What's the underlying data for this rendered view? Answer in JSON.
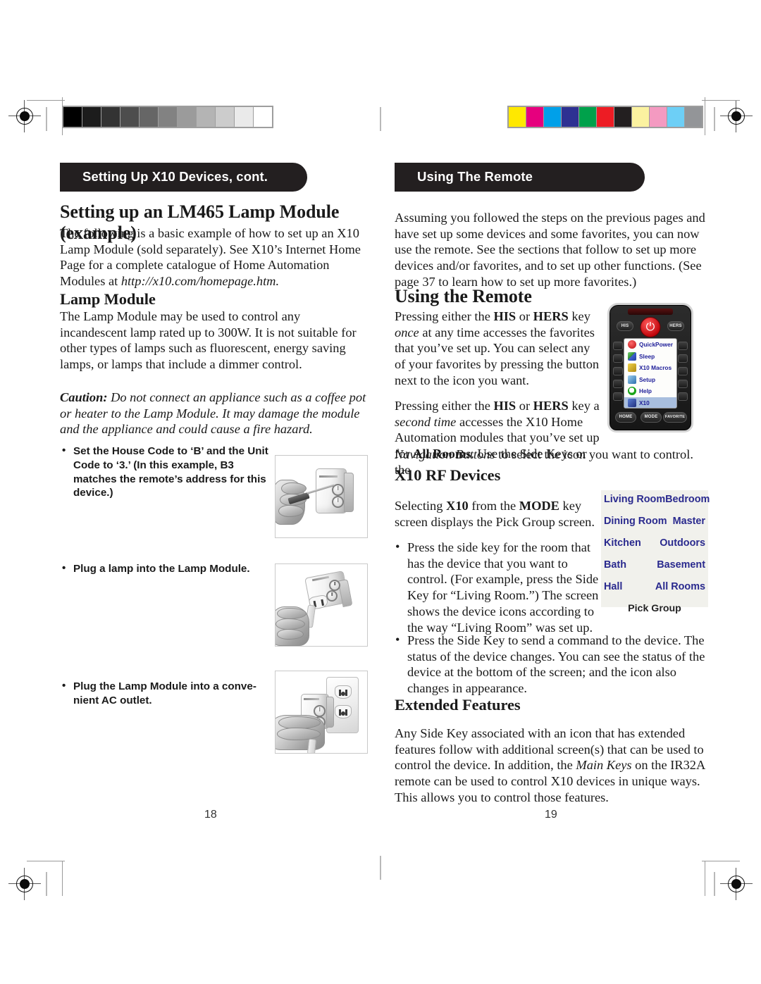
{
  "document": {
    "type": "printed-manual-spread",
    "left_page_number": "18",
    "right_page_number": "19"
  },
  "print_marks": {
    "grayscale_wedge": [
      "#000000",
      "#1c1c1c",
      "#333333",
      "#4d4d4d",
      "#666666",
      "#828282",
      "#9b9b9b",
      "#b4b4b4",
      "#cccccc",
      "#eaeaea",
      "#ffffff"
    ],
    "color_bar": [
      "#ffe800",
      "#e6007e",
      "#00a0e9",
      "#2e3192",
      "#00a14b",
      "#ed1c24",
      "#231f20",
      "#fbf2a0",
      "#f49ac1",
      "#6dcff6",
      "#939598"
    ]
  },
  "left_page": {
    "section_bar": "Setting Up X10 Devices, cont.",
    "heading_lm465": "Setting up an LM465 Lamp Module (example)",
    "intro": "The following is a basic example of how to set up an X10 Lamp Module (sold separately). See X10’s Internet Home Page for a complete catalogue of Home Automation Modules at ",
    "intro_url": "http://x10.com/homepage.htm.",
    "heading_lamp_module": "Lamp Module",
    "lamp_module_text": "The Lamp Module may be used to control any incandescent lamp rated up to 300W. It is not suitable for other types of lamps such as fluorescent, energy saving lamps, or lamps that include a dimmer control.",
    "caution_label": "Caution:",
    "caution_text": " Do not connect an appliance such as a coffee pot or heater to the Lamp Module. It may damage the module and the appliance and could cause a fire hazard.",
    "steps": [
      "Set the House Code to ‘B’ and the Unit Code to ‘3.’ (In this example, B3 matches the remote’s address for this device.)",
      "Plug a lamp into the Lamp Module.",
      "Plug the Lamp Module into a conve-\nnient AC outlet."
    ],
    "photo_captions": [
      "photo-setting-house-and-unit-code-with-screwdriver",
      "photo-plugging-lamp-cord-into-module",
      "photo-plugging-module-into-wall-outlet"
    ]
  },
  "right_page": {
    "section_bar": "Using The Remote",
    "intro": "Assuming you followed the steps on the previous pages and have set up some devices and some favorites, you can now use the remote. See the sections that follow to set up more devices and/or favorites, and to set up other functions. (See page 37 to learn how to set up more favorites.)",
    "heading_using_remote": "Using the Remote",
    "para1": {
      "a": "Pressing either the ",
      "his": "HIS",
      "b": " or ",
      "hers": "HERS",
      "c": " key ",
      "once": "once",
      "d": " at any time accesses the favorites that you’ve set up. You can select any of your favorites by pressing the button next to the icon you want."
    },
    "para2": {
      "a": "Pressing either the ",
      "his": "HIS",
      "b": " or ",
      "hers": "HERS",
      "c": " key a ",
      "second_time": "second time",
      "d": " accesses the X10 Home Automation modules that you’ve set up for ",
      "all_rooms": "All Rooms",
      "e": ". Use the Side Keys or the ",
      "nav": "Navigation Buttons",
      "f": " to select the icon you want to control."
    },
    "heading_rf_devices": "X10 RF Devices",
    "rf_para": {
      "a": "Selecting ",
      "x10": "X10",
      "b": " from the ",
      "mode": "MODE",
      "c": " key screen displays the Pick Group screen."
    },
    "rf_bullets": [
      "Press the side key for the room that has the device that you want to control. (For example, press the Side Key for “Living Room.”) The screen shows the device icons according to the way “Living Room” was set up.",
      "Press the Side Key to send a command to the device. The status of the device changes. You can see the status of the device at the bottom of the screen; and the icon also changes in appearance."
    ],
    "heading_extended": "Extended Features",
    "extended": {
      "a": "Any Side Key associated with an icon that has extended features follow with additional screen(s) that can be used to control the device. In addition, the ",
      "main_keys": "Main Keys",
      "b": " on the IR32A remote can be used to control X10 devices in unique ways. This allows you to control those features."
    }
  },
  "remote_illustration": {
    "top_left_key": "HIS",
    "top_right_key": "HERS",
    "power_icon": "power-icon",
    "menu_items": [
      {
        "icon": "quickpower-icon",
        "label": "QuickPower",
        "selected": false
      },
      {
        "icon": "sleep-icon",
        "label": "Sleep",
        "selected": false
      },
      {
        "icon": "x10-macros-icon",
        "label": "X10 Macros",
        "selected": false
      },
      {
        "icon": "setup-icon",
        "label": "Setup",
        "selected": false
      },
      {
        "icon": "help-icon",
        "label": "Help",
        "selected": false
      },
      {
        "icon": "x10-icon",
        "label": "X10",
        "selected": true
      }
    ],
    "bottom_keys": [
      "HOME",
      "MODE",
      "FAVORITE"
    ]
  },
  "pick_group_screen": {
    "rows": [
      [
        "Living Room",
        "Bedroom"
      ],
      [
        "Dining Room",
        "Master"
      ],
      [
        "Kitchen",
        "Outdoors"
      ],
      [
        "Bath",
        "Basement"
      ],
      [
        "Hall",
        "All Rooms"
      ]
    ],
    "caption": "Pick Group",
    "text_color": "#2a2a8e",
    "background": "#f1f1ec"
  }
}
